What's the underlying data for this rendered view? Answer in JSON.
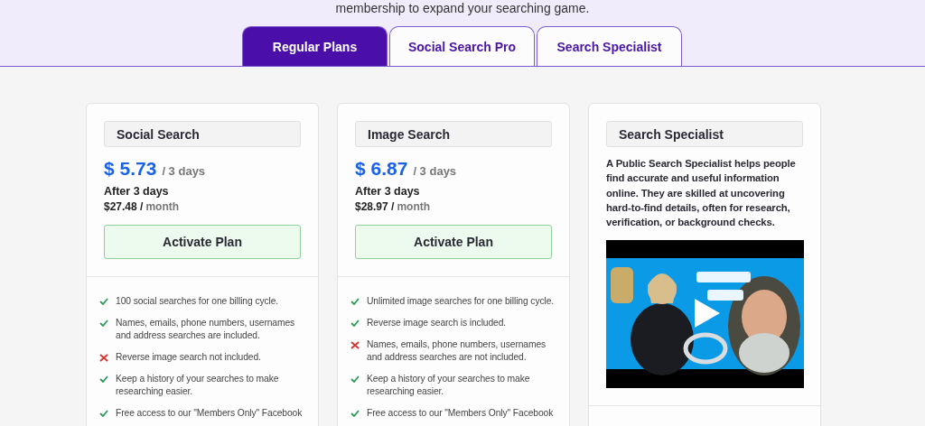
{
  "intro": "membership to expand your searching game.",
  "tabs": [
    {
      "label": "Regular Plans",
      "selected": true
    },
    {
      "label": "Social Search Pro",
      "selected": false
    },
    {
      "label": "Search Specialist",
      "selected": false
    }
  ],
  "plans": [
    {
      "kind": "plan",
      "name": "Social Search",
      "price": "$ 5.73",
      "period": "/ 3 days",
      "after": "After 3 days",
      "renewal_price": "$27.48 /",
      "renewal_period": "month",
      "button": "Activate Plan",
      "features": [
        {
          "kind": "included",
          "text": "100 social searches for one billing cycle."
        },
        {
          "kind": "included",
          "text": "Names, emails, phone numbers, usernames and address searches are included."
        },
        {
          "kind": "excluded",
          "text": "Reverse image search not included."
        },
        {
          "kind": "included",
          "text": "Keep a history of your searches to make researching easier."
        },
        {
          "kind": "included",
          "text": "Free access to our \"Members Only\" Facebook"
        }
      ]
    },
    {
      "kind": "plan",
      "name": "Image Search",
      "price": "$ 6.87",
      "period": "/ 3 days",
      "after": "After 3 days",
      "renewal_price": "$28.97 /",
      "renewal_period": "month",
      "button": "Activate Plan",
      "features": [
        {
          "kind": "included",
          "text": "Unlimited image searches for one billing cycle."
        },
        {
          "kind": "included",
          "text": "Reverse image search is included."
        },
        {
          "kind": "excluded",
          "text": "Names, emails, phone numbers, usernames and address searches are not included."
        },
        {
          "kind": "included",
          "text": "Keep a history of your searches to make researching easier."
        },
        {
          "kind": "included",
          "text": "Free access to our \"Members Only\" Facebook"
        }
      ]
    },
    {
      "kind": "info",
      "name": "Search Specialist",
      "description": "A Public Search Specialist helps people find accurate and useful information online. They are skilled at uncovering hard-to-find details, often for research, verification, or background checks."
    }
  ]
}
